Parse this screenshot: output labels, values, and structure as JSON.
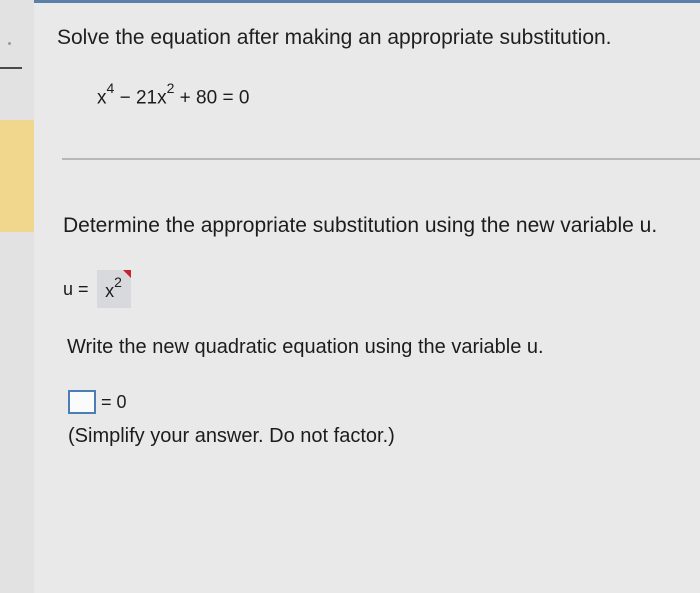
{
  "question": {
    "title": "Solve the equation after making an appropriate substitution.",
    "equation": {
      "base1": "x",
      "exp1": "4",
      "middle": " − 21x",
      "exp2": "2",
      "tail": " + 80 = 0"
    }
  },
  "step1": {
    "instruction": "Determine the appropriate substitution using the new variable u.",
    "lhs": "u =",
    "answer_base": "x",
    "answer_exp": "2"
  },
  "step2": {
    "instruction": "Write the new quadratic equation using the variable u.",
    "rhs": "= 0",
    "input_value": "",
    "hint": "(Simplify your answer. Do not factor.)"
  },
  "colors": {
    "highlight": "#f1d68e",
    "input_border": "#4a7eb4",
    "answer_flag": "#c4242e"
  }
}
